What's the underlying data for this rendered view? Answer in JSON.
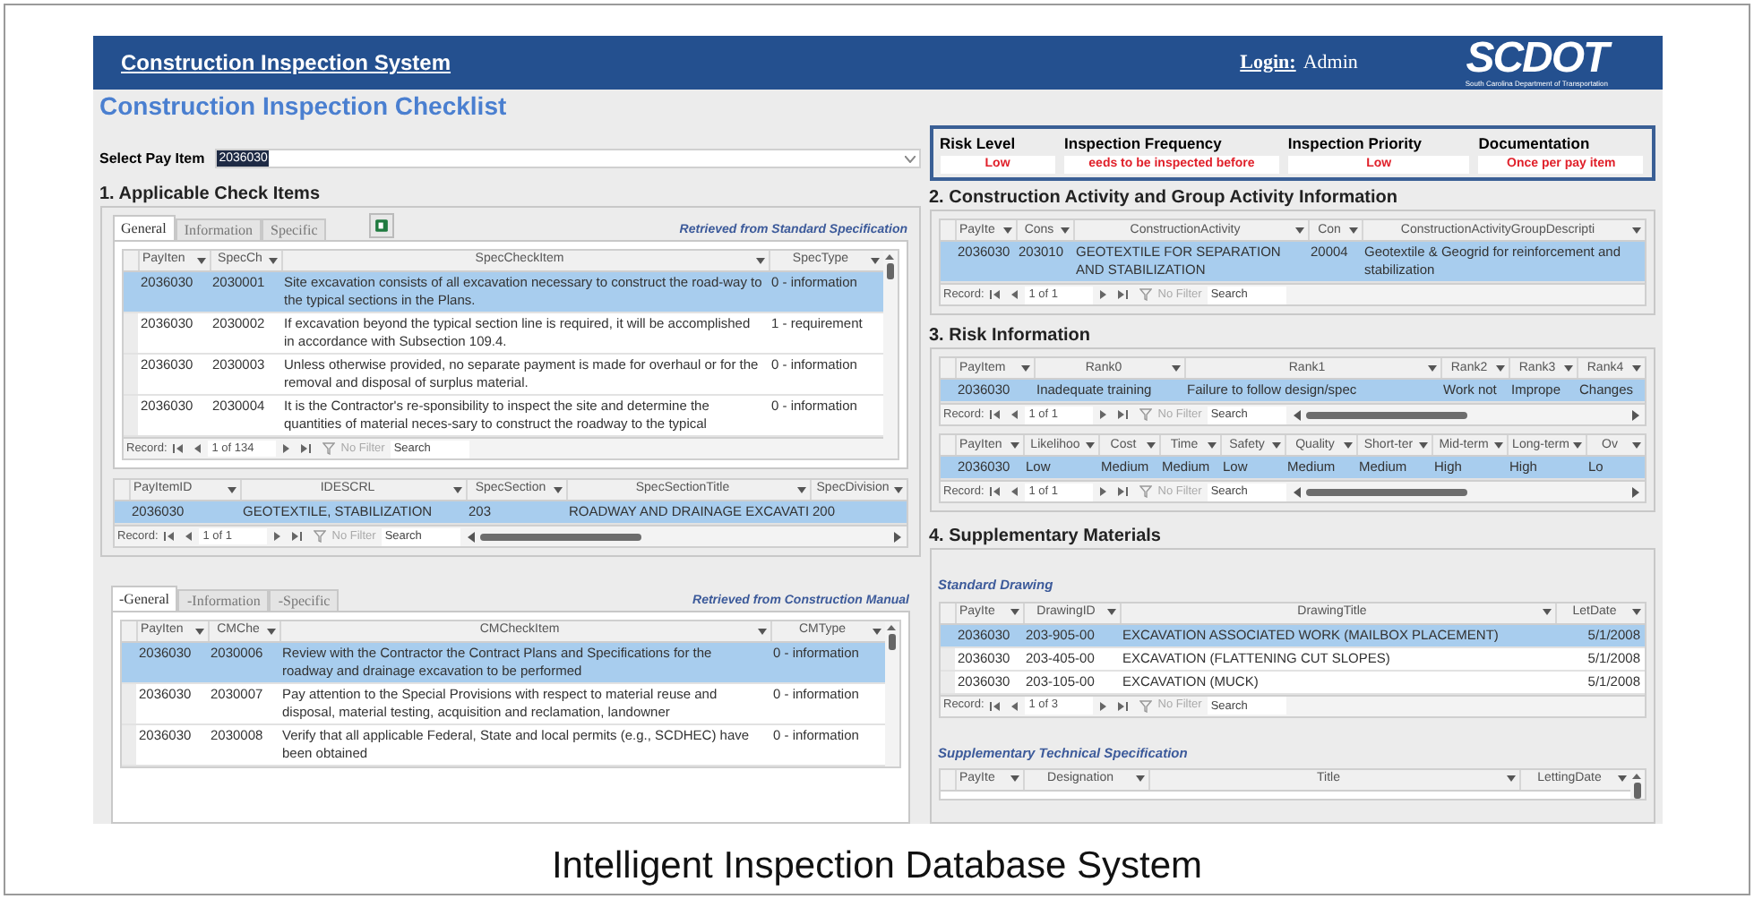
{
  "header": {
    "system_title": "Construction Inspection System",
    "login_label": "Login:",
    "login_user": "Admin",
    "logo_text": "SCDOT",
    "logo_subtitle": "South Carolina Department of Transportation"
  },
  "page_title": "Construction Inspection Checklist",
  "pay_item": {
    "label": "Select Pay Item",
    "value": "2036030"
  },
  "applicable_check_items": {
    "title": "1. Applicable Check Items",
    "tabs": [
      {
        "label": "General",
        "selected": true
      },
      {
        "label": "Information",
        "selected": false
      },
      {
        "label": "Specific",
        "selected": false
      }
    ],
    "source_note": "Retrieved from Standard Specification",
    "spec_table": {
      "columns": [
        "PayIten",
        "SpecCh",
        "SpecCheckItem",
        "SpecType"
      ],
      "rows": [
        {
          "cells": [
            "2036030",
            "2030001",
            "Site excavation consists of all excavation necessary to construct the road-way to the typical sections in the Plans.",
            "0 - information"
          ],
          "selected": true
        },
        {
          "cells": [
            "2036030",
            "2030002",
            "If excavation beyond the typical section line is required, it will be accomplished in accordance with Subsection 109.4.",
            "1 - requirement"
          ],
          "selected": false
        },
        {
          "cells": [
            "2036030",
            "2030003",
            "Unless otherwise provided, no separate payment is made for overhaul or for the removal and disposal of surplus material.",
            "0 - information"
          ],
          "selected": false
        },
        {
          "cells": [
            "2036030",
            "2030004",
            "It is the Contractor's re-sponsibility to inspect the site and determine the quantities of material neces-sary to construct the roadway to the typical",
            "0 - information"
          ],
          "selected": false
        }
      ],
      "navigator": {
        "record_label": "Record:",
        "position": "1 of 134",
        "filter_label": "No Filter",
        "search_placeholder": "Search"
      }
    },
    "section_table": {
      "columns": [
        "PayItemID",
        "IDESCRL",
        "SpecSection",
        "SpecSectionTitle",
        "SpecDivision"
      ],
      "rows": [
        {
          "cells": [
            "2036030",
            "GEOTEXTILE, STABILIZATION",
            "203",
            "ROADWAY AND DRAINAGE EXCAVATI",
            "200"
          ],
          "selected": true
        }
      ],
      "navigator": {
        "record_label": "Record:",
        "position": "1 of 1",
        "filter_label": "No Filter",
        "search_placeholder": "Search"
      }
    },
    "cm_tabs": [
      {
        "label": "-General",
        "selected": true
      },
      {
        "label": "-Information",
        "selected": false
      },
      {
        "label": "-Specific",
        "selected": false
      }
    ],
    "cm_source_note": "Retrieved from Construction Manual",
    "cm_table": {
      "columns": [
        "PayIten",
        "CMChe",
        "CMCheckItem",
        "CMType"
      ],
      "rows": [
        {
          "cells": [
            "2036030",
            "2030006",
            "Review with the Contractor the Contract Plans and Specifications for the roadway and drainage excavation to be performed",
            "0 - information"
          ],
          "selected": true
        },
        {
          "cells": [
            "2036030",
            "2030007",
            "Pay attention to the Special Provisions with respect to material reuse and disposal, material testing, acquisition and reclamation, landowner",
            "0 - information"
          ],
          "selected": false
        },
        {
          "cells": [
            "2036030",
            "2030008",
            "Verify that all applicable Federal, State and local permits (e.g., SCDHEC) have been obtained",
            "0 - information"
          ],
          "selected": false
        }
      ]
    }
  },
  "summary": [
    {
      "label": "Risk Level",
      "value": "Low"
    },
    {
      "label": "Inspection Frequency",
      "value": "eeds to be inspected before"
    },
    {
      "label": "Inspection Priority",
      "value": "Low"
    },
    {
      "label": "Documentation",
      "value": "Once per pay item"
    }
  ],
  "activity": {
    "title": "2. Construction Activity and Group Activity Information",
    "table": {
      "columns": [
        "PayIte",
        "Cons",
        "ConstructionActivity",
        "Con",
        "ConstructionActivityGroupDescripti"
      ],
      "rows": [
        {
          "cells": [
            "2036030",
            "203010",
            "GEOTEXTILE FOR SEPARATION AND STABILIZATION",
            "20004",
            "Geotextile & Geogrid for reinforcement and stabilization"
          ],
          "selected": true
        }
      ],
      "navigator": {
        "record_label": "Record:",
        "position": "1 of 1",
        "filter_label": "No Filter",
        "search_placeholder": "Search"
      }
    }
  },
  "risk": {
    "title": "3. Risk Information",
    "rank_table": {
      "columns": [
        "PayItem",
        "Rank0",
        "Rank1",
        "Rank2",
        "Rank3",
        "Rank4"
      ],
      "rows": [
        {
          "cells": [
            "2036030",
            "Inadequate training",
            "Failure to follow design/spec",
            "Work not",
            "Imprope",
            "Changes"
          ],
          "selected": true
        }
      ],
      "navigator": {
        "record_label": "Record:",
        "position": "1 of 1",
        "filter_label": "No Filter",
        "search_placeholder": "Search"
      }
    },
    "impact_table": {
      "columns": [
        "PayIten",
        "Likelihoo",
        "Cost",
        "Time",
        "Safety",
        "Quality",
        "Short-ter",
        "Mid-term",
        "Long-term",
        "Ov"
      ],
      "rows": [
        {
          "cells": [
            "2036030",
            "Low",
            "Medium",
            "Medium",
            "Low",
            "Medium",
            "Medium",
            "High",
            "High",
            "Lo"
          ],
          "selected": true
        }
      ],
      "navigator": {
        "record_label": "Record:",
        "position": "1 of 1",
        "filter_label": "No Filter",
        "search_placeholder": "Search"
      }
    }
  },
  "supplementary": {
    "title": "4. Supplementary Materials",
    "drawing_label": "Standard Drawing",
    "drawing_table": {
      "columns": [
        "PayIte",
        "DrawingID",
        "DrawingTitle",
        "LetDate"
      ],
      "rows": [
        {
          "cells": [
            "2036030",
            "203-905-00",
            "EXCAVATION ASSOCIATED WORK (MAILBOX PLACEMENT)",
            "5/1/2008"
          ],
          "selected": true
        },
        {
          "cells": [
            "2036030",
            "203-405-00",
            "EXCAVATION (FLATTENING CUT SLOPES)",
            "5/1/2008"
          ],
          "selected": false
        },
        {
          "cells": [
            "2036030",
            "203-105-00",
            "EXCAVATION (MUCK)",
            "5/1/2008"
          ],
          "selected": false
        }
      ],
      "navigator": {
        "record_label": "Record:",
        "position": "1 of 3",
        "filter_label": "No Filter",
        "search_placeholder": "Search"
      }
    },
    "spec_label": "Supplementary Technical Specification",
    "spec_table": {
      "columns": [
        "PayIte",
        "Designation",
        "Title",
        "LettingDate"
      ]
    }
  },
  "caption": "Intelligent Inspection Database System"
}
